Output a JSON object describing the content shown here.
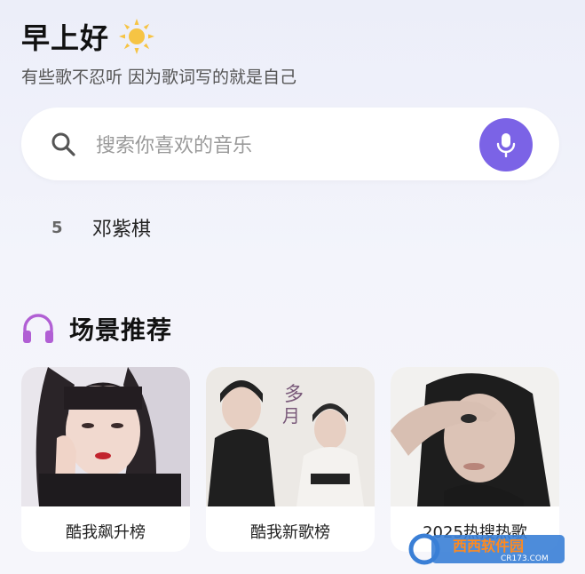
{
  "header": {
    "greeting": "早上好",
    "subtitle": "有些歌不忍听 因为歌词写的就是自己",
    "greeting_icon": "sun-icon"
  },
  "search": {
    "placeholder": "搜索你喜欢的音乐",
    "voice_icon": "mic-icon",
    "accent_color": "#7b63e6"
  },
  "hot_search": {
    "rank": "5",
    "name": "邓紫棋"
  },
  "scene": {
    "title": "场景推荐",
    "icon": "headphones-icon",
    "cards": [
      {
        "label": "酷我飙升榜"
      },
      {
        "label": "酷我新歌榜"
      },
      {
        "label": "2025热搜热歌"
      }
    ]
  },
  "watermark": {
    "brand": "西西软件园",
    "domain": "CR173.COM"
  }
}
